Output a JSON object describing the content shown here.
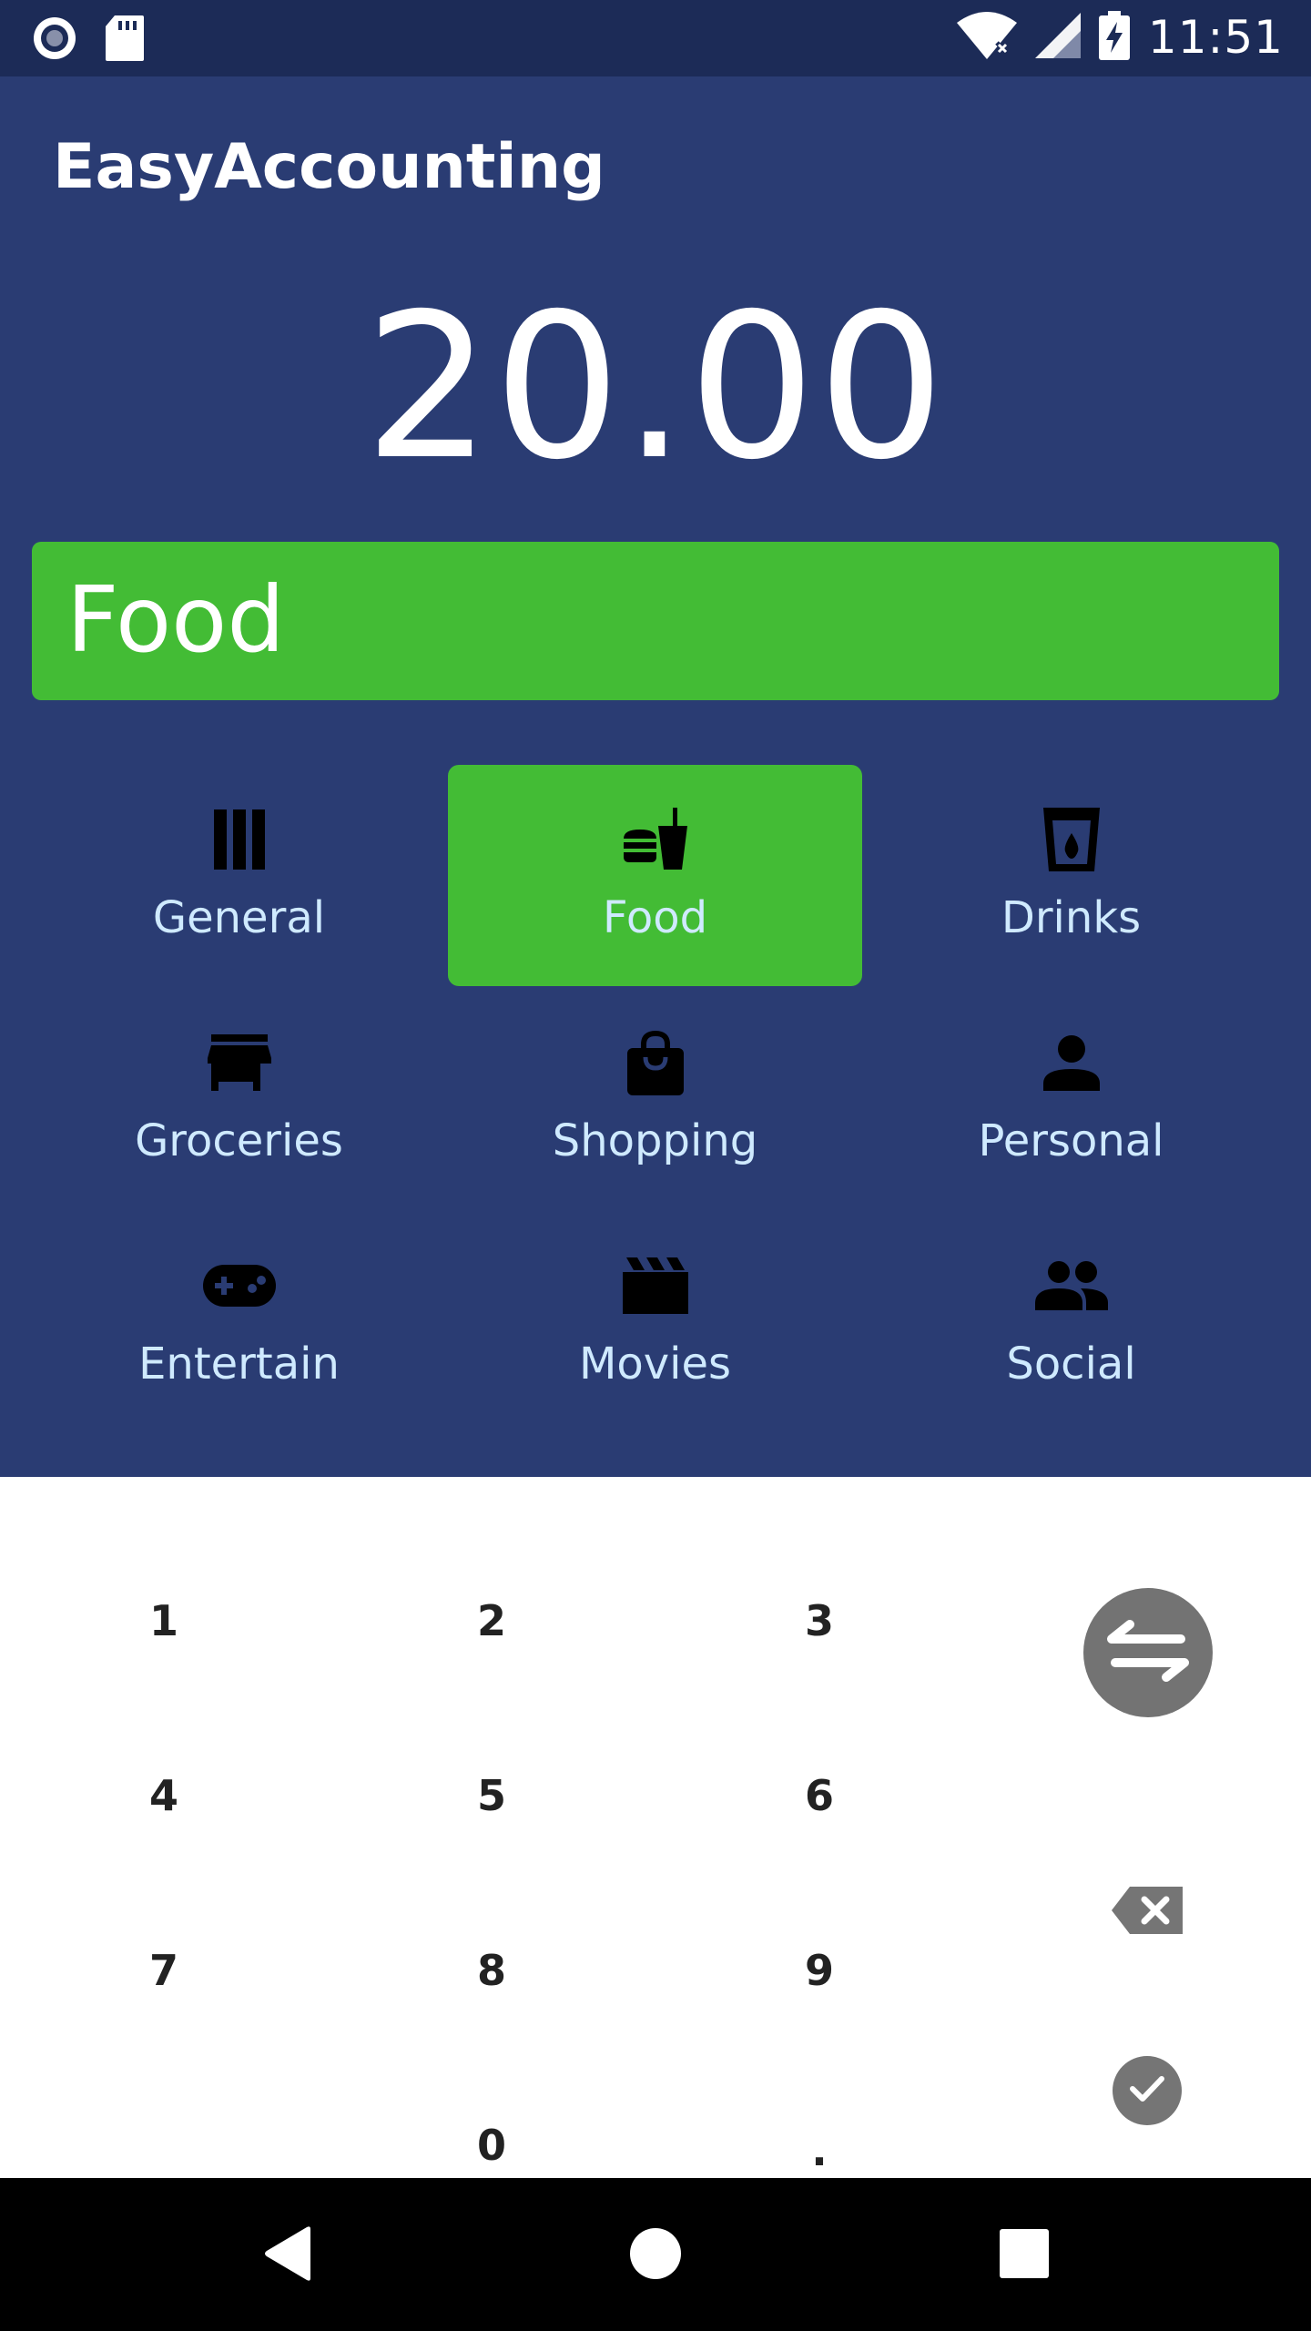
{
  "status_bar": {
    "time": "11:51",
    "icons": [
      "record-icon",
      "sd-card-icon",
      "wifi-icon",
      "signal-icon",
      "battery-charging-icon"
    ]
  },
  "app": {
    "title": "EasyAccounting"
  },
  "amount": {
    "value": "20.00"
  },
  "selected_category": {
    "label": "Food",
    "color": "#43bc35"
  },
  "categories": [
    {
      "label": "General",
      "icon": "columns-icon",
      "active": false
    },
    {
      "label": "Food",
      "icon": "fastfood-icon",
      "active": true
    },
    {
      "label": "Drinks",
      "icon": "drink-icon",
      "active": false
    },
    {
      "label": "Groceries",
      "icon": "store-icon",
      "active": false
    },
    {
      "label": "Shopping",
      "icon": "shopping-bag-icon",
      "active": false
    },
    {
      "label": "Personal",
      "icon": "person-icon",
      "active": false
    },
    {
      "label": "Entertain",
      "icon": "gamepad-icon",
      "active": false
    },
    {
      "label": "Movies",
      "icon": "movie-clapper-icon",
      "active": false
    },
    {
      "label": "Social",
      "icon": "people-icon",
      "active": false
    }
  ],
  "keypad": {
    "keys": [
      "1",
      "2",
      "3",
      "4",
      "5",
      "6",
      "7",
      "8",
      "9",
      "0",
      "."
    ],
    "actions": [
      "swap-icon",
      "backspace-icon",
      "check-icon"
    ]
  },
  "navigation": {
    "buttons": [
      "back-icon",
      "home-icon",
      "recents-icon"
    ]
  },
  "colors": {
    "background": "#2a3c73",
    "status_bar": "#1c2b57",
    "accent": "#43bc35",
    "category_label": "#cfeaff",
    "keypad_bg": "#ffffff"
  }
}
